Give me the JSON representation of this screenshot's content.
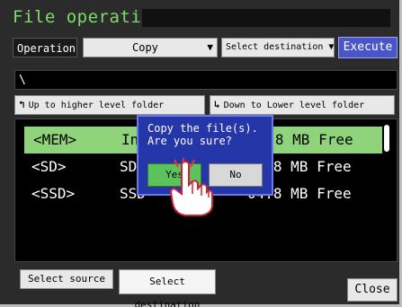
{
  "window": {
    "title": "File operation"
  },
  "toolbar": {
    "operation_label": "Operation",
    "operation_value": "Copy",
    "destination_label": "Select destination",
    "execute_label": "Execute"
  },
  "path": {
    "current": "\\"
  },
  "navigation": {
    "up_label": "Up to higher level folder",
    "down_label": "Down to Lower level folder"
  },
  "file_list": {
    "rows": [
      {
        "name": "<MEM>",
        "type": "In",
        "free": "04.8 MB Free",
        "selected": true
      },
      {
        "name": "<SD>",
        "type": "SD",
        "free": "04.8 MB Free",
        "selected": false
      },
      {
        "name": "<SSD>",
        "type": "SSD",
        "free": "04.8 MB Free",
        "selected": false
      }
    ]
  },
  "dialog": {
    "message_line1": "Copy the file(s).",
    "message_line2": "Are you sure?",
    "yes_label": "Yes",
    "no_label": "No"
  },
  "footer": {
    "select_source_label": "Select source",
    "select_destination_label": "Select destination",
    "close_label": "Close"
  },
  "colors": {
    "title_green": "#7ddc6a",
    "execute_blue": "#4a56c8",
    "selected_row": "#8fd47a",
    "dialog_blue": "#2436a8",
    "yes_green": "#5cc25c"
  },
  "icons": [
    "up-arrow-icon",
    "down-arrow-icon",
    "dropdown-arrow-icon",
    "pointing-hand-icon"
  ]
}
